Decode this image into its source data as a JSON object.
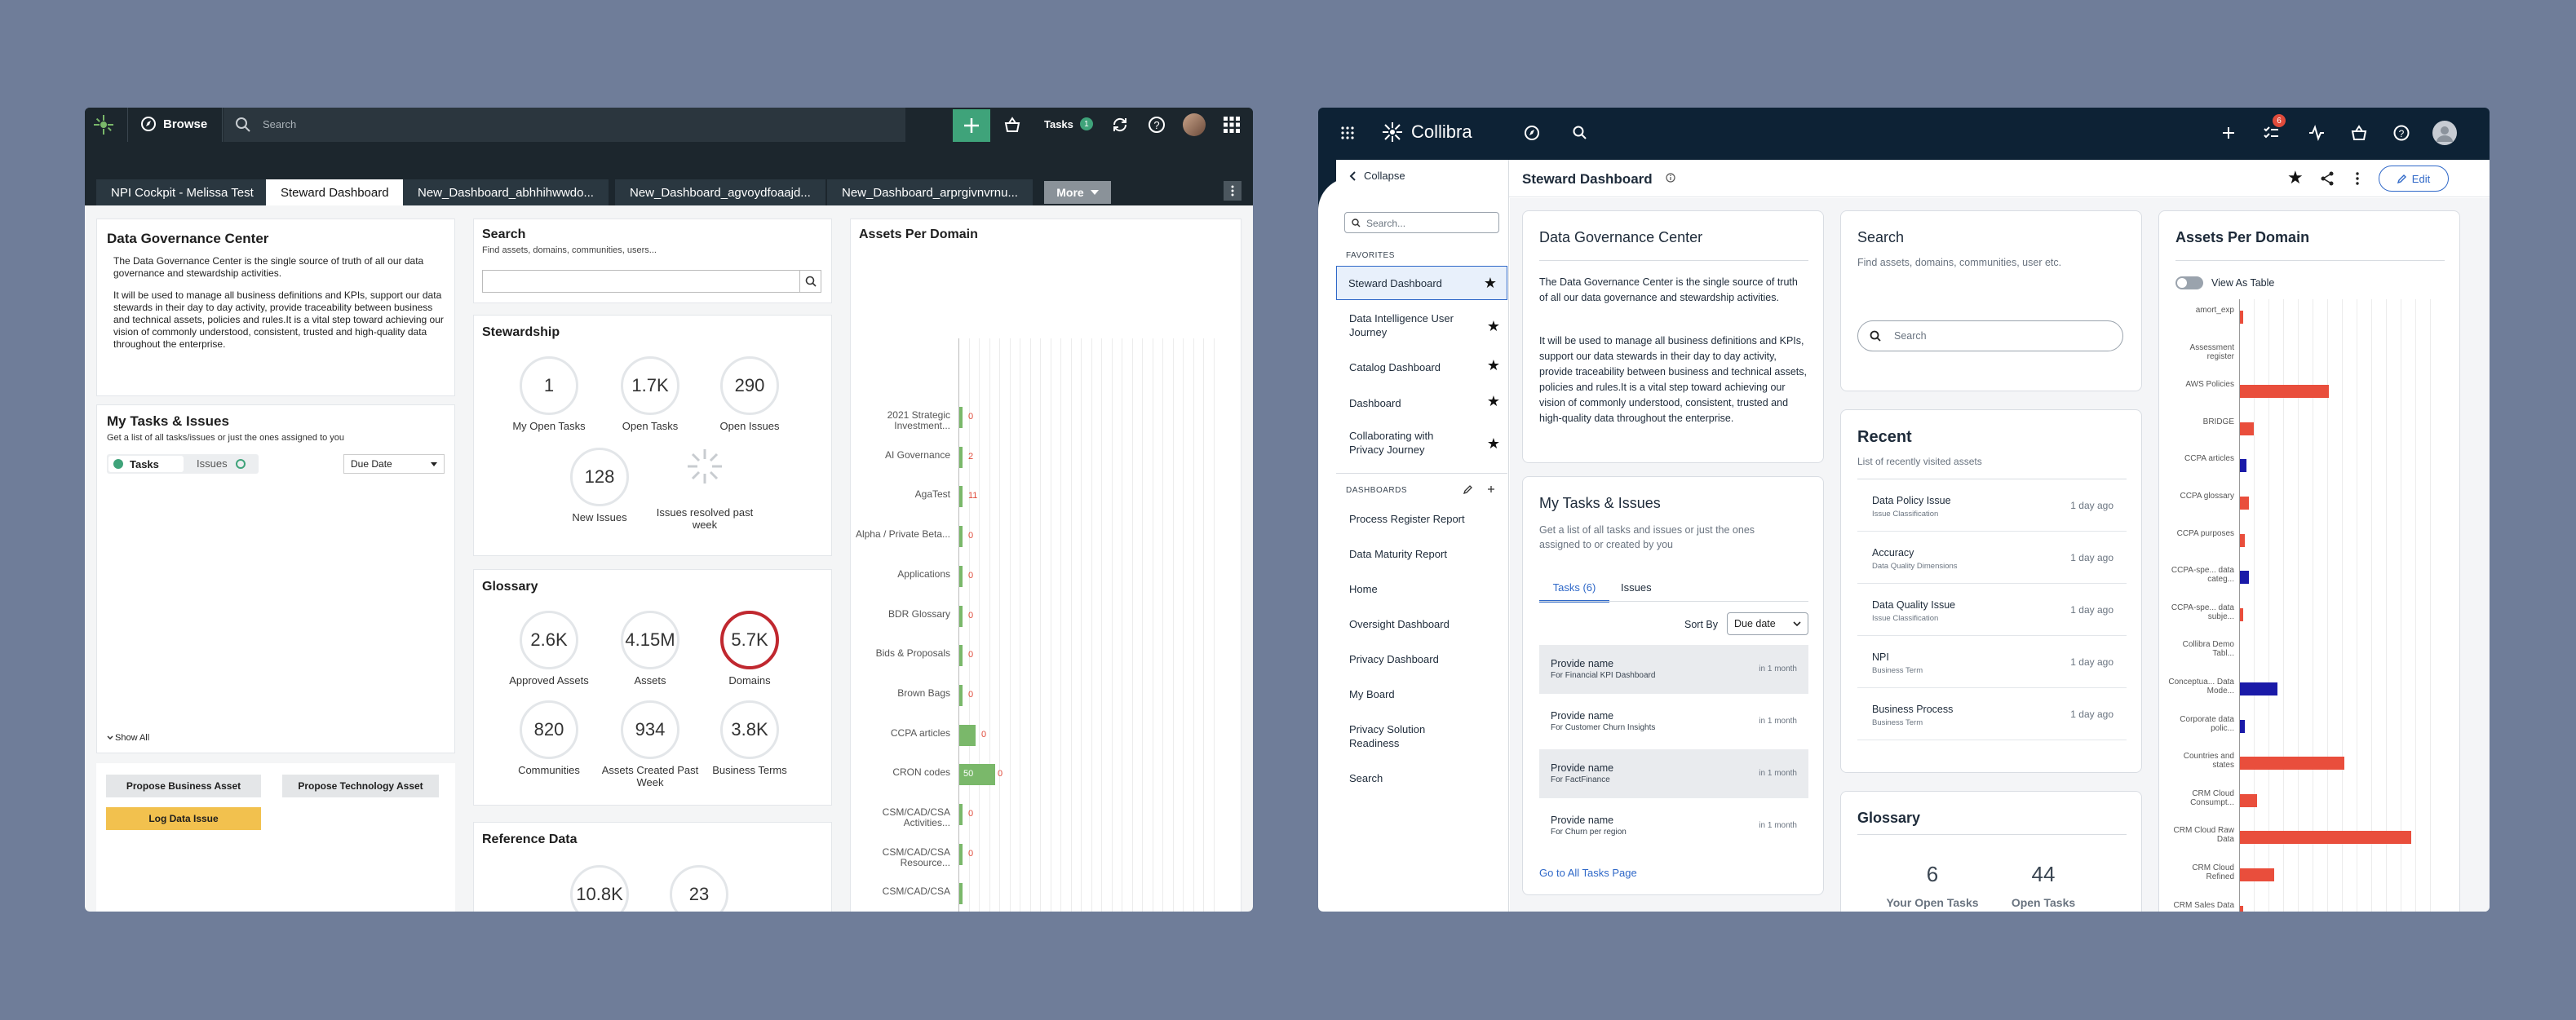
{
  "left": {
    "topbar": {
      "browse": "Browse",
      "search_placeholder": "Search",
      "tasks_label": "Tasks",
      "tasks_count": "1"
    },
    "tabs": [
      "NPI Cockpit - Melissa Test",
      "Steward Dashboard",
      "New_Dashboard_abhhihwwdo...",
      "New_Dashboard_agvoydfoaajd...",
      "New_Dashboard_arprgivnvrnu..."
    ],
    "more": "More",
    "dgc": {
      "title": "Data Governance Center",
      "p1": "The Data Governance Center is the single source of truth of all our data governance and stewardship activities.",
      "p2": "It will be used to manage all business definitions and KPIs, support our data stewards in their day to day activity, provide traceability between business and technical assets, policies and rules.It is a vital step toward achieving our vision of commonly understood, consistent, trusted and high-quality data throughout the enterprise."
    },
    "tasks": {
      "title": "My Tasks & Issues",
      "subtitle": "Get a list of all tasks/issues or just the ones assigned to you",
      "tab_tasks": "Tasks",
      "tab_issues": "Issues",
      "sort": "Due Date",
      "show_all": "Show All"
    },
    "actions": {
      "propose_business": "Propose Business Asset",
      "propose_tech": "Propose Technology Asset",
      "log_issue": "Log Data Issue"
    },
    "search": {
      "title": "Search",
      "subtitle": "Find assets, domains, communities, users..."
    },
    "stewardship": {
      "title": "Stewardship",
      "items": [
        {
          "value": "1",
          "label": "My Open Tasks"
        },
        {
          "value": "1.7K",
          "label": "Open Tasks"
        },
        {
          "value": "290",
          "label": "Open Issues"
        },
        {
          "value": "128",
          "label": "New Issues"
        },
        {
          "value": "",
          "label": "Issues resolved past week"
        }
      ]
    },
    "glossary": {
      "title": "Glossary",
      "items": [
        {
          "value": "2.6K",
          "label": "Approved Assets"
        },
        {
          "value": "4.15M",
          "label": "Assets"
        },
        {
          "value": "5.7K",
          "label": "Domains"
        },
        {
          "value": "820",
          "label": "Communities"
        },
        {
          "value": "934",
          "label": "Assets Created Past Week"
        },
        {
          "value": "3.8K",
          "label": "Business Terms"
        }
      ]
    },
    "reference": {
      "title": "Reference Data",
      "items": [
        {
          "value": "10.8K"
        },
        {
          "value": "23"
        }
      ]
    },
    "apd": {
      "title": "Assets Per Domain",
      "rows": [
        {
          "label": "2021 Strategic Investment...",
          "value": "0",
          "bar": 0
        },
        {
          "label": "AI Governance",
          "value": "2",
          "bar": 0
        },
        {
          "label": "AgaTest",
          "value": "11",
          "bar": 0
        },
        {
          "label": "Alpha / Private Beta...",
          "value": "0",
          "bar": 0
        },
        {
          "label": "Applications",
          "value": "0",
          "bar": 0
        },
        {
          "label": "BDR Glossary",
          "value": "0",
          "bar": 0
        },
        {
          "label": "Bids & Proposals",
          "value": "0",
          "bar": 0
        },
        {
          "label": "Brown Bags",
          "value": "0",
          "bar": 0
        },
        {
          "label": "CCPA articles",
          "value": "0",
          "bar": 0.1
        },
        {
          "label": "CRON codes",
          "value": "50",
          "bar": 0.22
        },
        {
          "label": "CSM/CAD/CSA Activities...",
          "value": "0",
          "bar": 0
        },
        {
          "label": "CSM/CAD/CSA Resource...",
          "value": "0",
          "bar": 0
        },
        {
          "label": "CSM/CAD/CSA",
          "value": "",
          "bar": 0
        }
      ]
    }
  },
  "right": {
    "brand": "Collibra",
    "badge": "6",
    "collapse": "Collapse",
    "side_search_placeholder": "Search...",
    "favorites_label": "FAVORITES",
    "favorites": [
      "Steward Dashboard",
      "Data Intelligence User Journey",
      "Catalog Dashboard",
      "Dashboard",
      "Collaborating with Privacy Journey"
    ],
    "dashboards_label": "DASHBOARDS",
    "dashboards": [
      "Process Register Report",
      "Data Maturity Report",
      "Home",
      "Oversight Dashboard",
      "Privacy Dashboard",
      "My Board",
      "Privacy Solution Readiness",
      "Search"
    ],
    "page_title": "Steward Dashboard",
    "edit": "Edit",
    "dgc": {
      "title": "Data Governance Center",
      "p1": "The Data Governance Center is the single source of truth of all our data governance and stewardship activities.",
      "p2": "It will be used to manage all business definitions and KPIs, support our data stewards in their day to day activity, provide traceability between business and technical assets, policies and rules.It is a vital step toward achieving our vision of commonly understood, consistent, trusted and high-quality data throughout the enterprise."
    },
    "tasks": {
      "title": "My Tasks & Issues",
      "subtitle": "Get a list of all tasks and issues or just the ones assigned to or created by you",
      "tab_tasks": "Tasks (6)",
      "tab_issues": "Issues",
      "sort_by": "Sort By",
      "sort_value": "Due date",
      "link": "Go to All Tasks Page",
      "rows": [
        {
          "name": "Provide name",
          "sub": "For Financial KPI Dashboard",
          "due": "in 1 month"
        },
        {
          "name": "Provide name",
          "sub": "For Customer Churn Insights",
          "due": "in 1 month"
        },
        {
          "name": "Provide name",
          "sub": "For FactFinance",
          "due": "in 1 month"
        },
        {
          "name": "Provide name",
          "sub": "For Churn per region",
          "due": "in 1 month"
        }
      ]
    },
    "search": {
      "title": "Search",
      "subtitle": "Find assets, domains, communities, user etc.",
      "placeholder": "Search"
    },
    "recent": {
      "title": "Recent",
      "subtitle": "List of recently visited assets",
      "rows": [
        {
          "name": "Data Policy Issue",
          "type": "Issue Classification",
          "time": "1 day ago"
        },
        {
          "name": "Accuracy",
          "type": "Data Quality Dimensions",
          "time": "1 day ago"
        },
        {
          "name": "Data Quality Issue",
          "type": "Issue Classification",
          "time": "1 day ago"
        },
        {
          "name": "NPI",
          "type": "Business Term",
          "time": "1 day ago"
        },
        {
          "name": "Business Process",
          "type": "Business Term",
          "time": "1 day ago"
        }
      ]
    },
    "glossary": {
      "title": "Glossary",
      "items": [
        {
          "value": "6",
          "label": "Your Open Tasks"
        },
        {
          "value": "44",
          "label": "Open Tasks"
        }
      ]
    },
    "apd": {
      "title": "Assets Per Domain",
      "toggle": "View As Table",
      "rows": [
        {
          "label": "amort_exp",
          "bar": 0.02,
          "color": "#e94e3c"
        },
        {
          "label": "Assessment register",
          "bar": 0,
          "color": "#e94e3c"
        },
        {
          "label": "AWS Policies",
          "bar": 0.52,
          "color": "#e94e3c"
        },
        {
          "label": "BRIDGE",
          "bar": 0.08,
          "color": "#e94e3c"
        },
        {
          "label": "CCPA articles",
          "bar": 0.04,
          "color": "#1a1aa8"
        },
        {
          "label": "CCPA glossary",
          "bar": 0.05,
          "color": "#e94e3c"
        },
        {
          "label": "CCPA purposes",
          "bar": 0.03,
          "color": "#e94e3c"
        },
        {
          "label": "CCPA-spe... data categ...",
          "bar": 0.05,
          "color": "#1a1aa8"
        },
        {
          "label": "CCPA-spe... data subje...",
          "bar": 0.02,
          "color": "#e94e3c"
        },
        {
          "label": "Collibra Demo Tabl...",
          "bar": 0,
          "color": "#e94e3c"
        },
        {
          "label": "Conceptua... Data Mode...",
          "bar": 0.22,
          "color": "#1a1aa8"
        },
        {
          "label": "Corporate data polic...",
          "bar": 0.03,
          "color": "#1a1aa8"
        },
        {
          "label": "Countries and states",
          "bar": 0.61,
          "color": "#e94e3c"
        },
        {
          "label": "CRM Cloud Consumpt...",
          "bar": 0.1,
          "color": "#e94e3c"
        },
        {
          "label": "CRM Cloud Raw Data",
          "bar": 1.0,
          "color": "#e94e3c"
        },
        {
          "label": "CRM Cloud Refined",
          "bar": 0.2,
          "color": "#e94e3c"
        },
        {
          "label": "CRM Sales Data",
          "bar": 0.02,
          "color": "#e94e3c"
        }
      ]
    }
  }
}
